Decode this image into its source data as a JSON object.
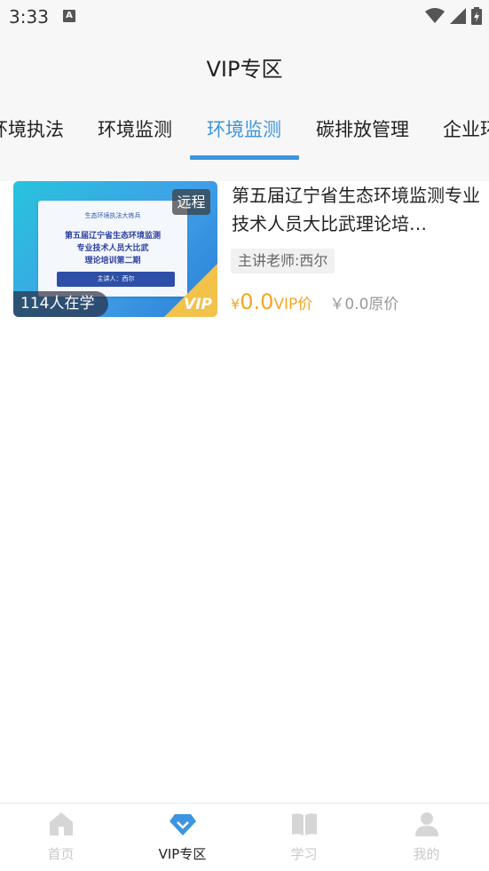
{
  "status_bar": {
    "time": "3:33",
    "notification_icon": "A"
  },
  "header": {
    "title": "VIP专区"
  },
  "tabs": [
    {
      "label": "环境执法",
      "active": false
    },
    {
      "label": "环境监测",
      "active": false
    },
    {
      "label": "环境监测",
      "active": true
    },
    {
      "label": "碳排放管理",
      "active": false
    },
    {
      "label": "企业环",
      "active": false
    }
  ],
  "course": {
    "title": "第五届辽宁省生态环境监测专业技术人员大比武理论培…",
    "remote_badge": "远程",
    "learners": "114人在学",
    "teacher": "主讲老师:西尔",
    "vip_currency": "¥",
    "vip_price": "0.0",
    "vip_label": "VIP价",
    "original_price": "￥0.0原价",
    "thumbnail": {
      "tag": "生态环境执法大练兵",
      "line1": "第五届辽宁省生态环境监测",
      "line2": "专业技术人员大比武",
      "line3": "理论培训第二期",
      "speaker": "主讲人：西尔",
      "corner_text": "VIP"
    }
  },
  "bottom_nav": [
    {
      "label": "首页",
      "icon": "home-icon",
      "active": false
    },
    {
      "label": "VIP专区",
      "icon": "diamond-icon",
      "active": true
    },
    {
      "label": "学习",
      "icon": "book-icon",
      "active": false
    },
    {
      "label": "我的",
      "icon": "user-icon",
      "active": false
    }
  ],
  "colors": {
    "accent": "#3d95e0",
    "price": "#f5a623",
    "inactive": "#c9c9c9"
  }
}
